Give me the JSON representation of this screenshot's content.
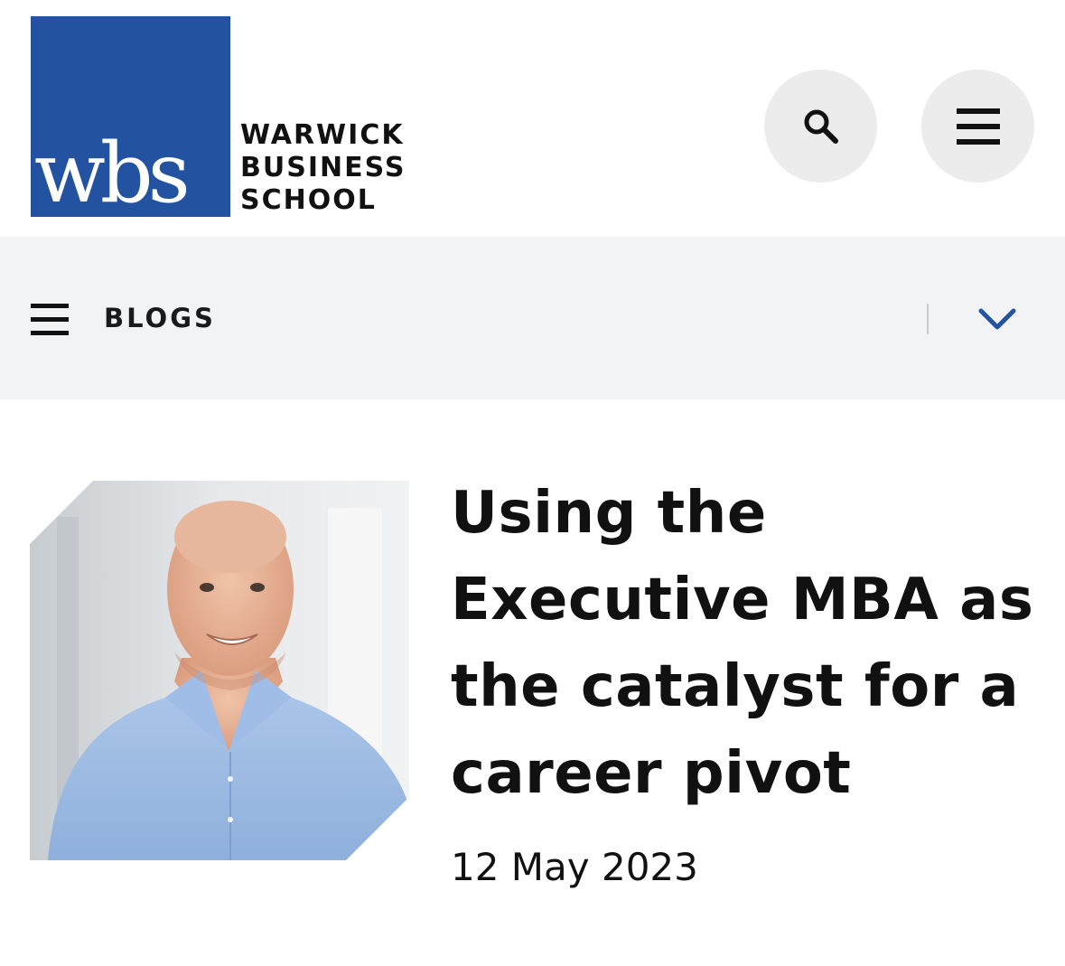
{
  "header": {
    "logo": {
      "mark": "wbs",
      "line1": "WARWICK",
      "line2": "BUSINESS",
      "line3": "SCHOOL"
    },
    "search_icon": "search-icon",
    "menu_icon": "hamburger-menu-icon"
  },
  "subnav": {
    "label": "BLOGS",
    "menu_icon": "hamburger-menu-icon",
    "toggle_icon": "chevron-down-icon"
  },
  "article": {
    "title": "Using the Executive MBA as the catalyst for a career pivot",
    "date": "12 May 2023"
  },
  "colors": {
    "brand_blue": "#2352a0",
    "subnav_bg": "#f2f3f5",
    "button_bg": "#ececec",
    "chevron": "#2352a0"
  }
}
